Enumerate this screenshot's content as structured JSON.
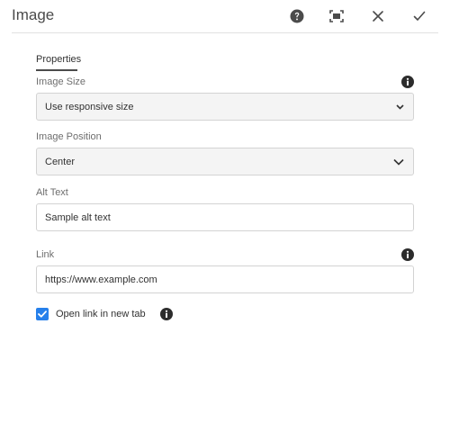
{
  "dialog": {
    "title": "Image"
  },
  "header_buttons": [
    {
      "name": "help-icon"
    },
    {
      "name": "fullscreen-icon"
    },
    {
      "name": "close-icon"
    },
    {
      "name": "checkmark-icon"
    }
  ],
  "tabs": [
    {
      "label": "Properties",
      "selected": true
    }
  ],
  "fields": {
    "image_size": {
      "label": "Image Size",
      "value": "Use responsive size"
    },
    "image_position": {
      "label": "Image Position",
      "value": "Center"
    },
    "alt_text": {
      "label": "Alt Text",
      "value": "Sample alt text"
    },
    "link": {
      "label": "Link",
      "value": "https://www.example.com"
    }
  },
  "checkbox": {
    "label": "Open link in new tab",
    "checked": true
  },
  "colors": {
    "accent": "#2680eb",
    "text": "#323232",
    "label": "#6e6e6e",
    "field_border": "#d3d3d3"
  }
}
